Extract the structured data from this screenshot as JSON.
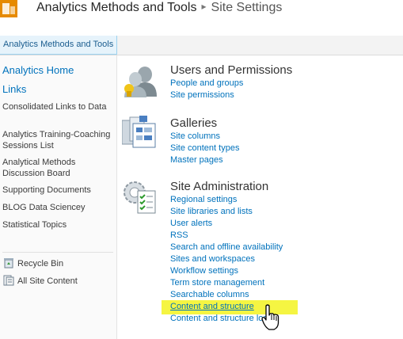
{
  "header": {
    "site_title": "Analytics Methods and Tools",
    "separator": "▸",
    "page_title": "Site Settings"
  },
  "topnav": {
    "tab_label": "Analytics Methods and Tools"
  },
  "leftnav": {
    "heading_home": "Analytics Home",
    "heading_links": "Links",
    "items": [
      "Consolidated Links to Data",
      "Analytics Training-Coaching Sessions List",
      "Analytical Methods Discussion Board",
      "Supporting Documents",
      "BLOG Data Sciencey",
      "Statistical Topics"
    ],
    "recycle_bin": "Recycle Bin",
    "all_site_content": "All Site Content"
  },
  "sections": {
    "users": {
      "title": "Users and Permissions",
      "links": [
        "People and groups",
        "Site permissions"
      ]
    },
    "galleries": {
      "title": "Galleries",
      "links": [
        "Site columns",
        "Site content types",
        "Master pages"
      ]
    },
    "admin": {
      "title": "Site Administration",
      "links": [
        "Regional settings",
        "Site libraries and lists",
        "User alerts",
        "RSS",
        "Search and offline availability",
        "Sites and workspaces",
        "Workflow settings",
        "Term store management",
        "Searchable columns",
        "Content and structure",
        "Content and structure logs"
      ]
    }
  },
  "colors": {
    "link": "#0072bc",
    "highlight": "#f5f542",
    "accent": "#e68a00"
  }
}
